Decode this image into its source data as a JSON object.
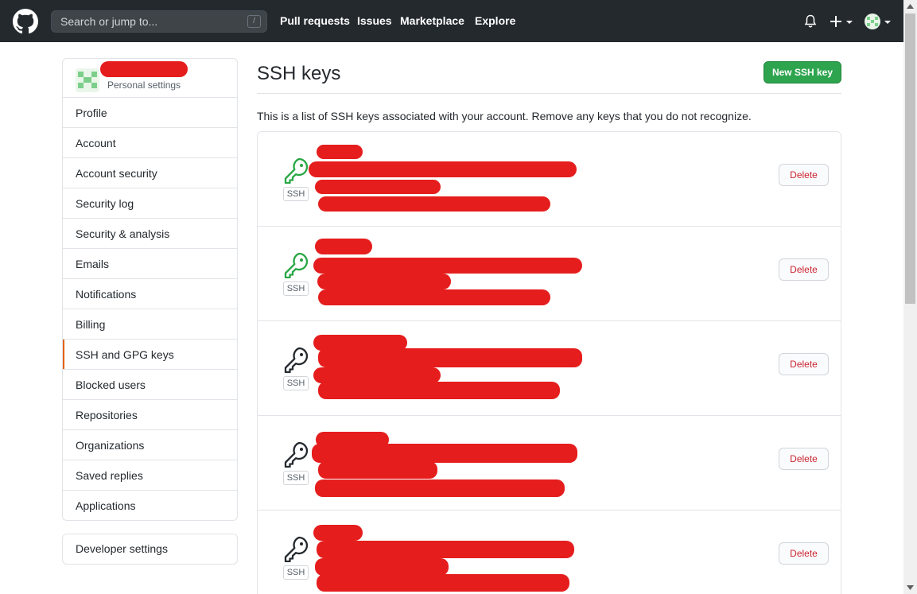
{
  "header": {
    "search_placeholder": "Search or jump to...",
    "search_shortcut": "/",
    "nav": [
      "Pull requests",
      "Issues",
      "Marketplace",
      "Explore"
    ]
  },
  "sidebar": {
    "subtitle": "Personal settings",
    "items": [
      {
        "label": "Profile"
      },
      {
        "label": "Account"
      },
      {
        "label": "Account security"
      },
      {
        "label": "Security log"
      },
      {
        "label": "Security & analysis"
      },
      {
        "label": "Emails"
      },
      {
        "label": "Notifications"
      },
      {
        "label": "Billing"
      },
      {
        "label": "SSH and GPG keys",
        "selected": true
      },
      {
        "label": "Blocked users"
      },
      {
        "label": "Repositories"
      },
      {
        "label": "Organizations"
      },
      {
        "label": "Saved replies"
      },
      {
        "label": "Applications"
      }
    ],
    "developer_settings": "Developer settings"
  },
  "main": {
    "title": "SSH keys",
    "new_button": "New SSH key",
    "description": "This is a list of SSH keys associated with your account. Remove any keys that you do not recognize."
  },
  "keys": [
    {
      "badge": "SSH",
      "delete_label": "Delete",
      "icon_color": "#28a745"
    },
    {
      "badge": "SSH",
      "delete_label": "Delete",
      "icon_color": "#28a745"
    },
    {
      "badge": "SSH",
      "delete_label": "Delete",
      "icon_color": "#24292e"
    },
    {
      "badge": "SSH",
      "delete_label": "Delete",
      "icon_color": "#24292e"
    },
    {
      "badge": "SSH",
      "delete_label": "Delete",
      "icon_color": "#24292e"
    }
  ],
  "colors": {
    "header_bg": "#24292e",
    "accent_green": "#2ea44f",
    "danger_red": "#cb2431",
    "selected_marker": "#e36209",
    "redaction": "#e51d1d"
  }
}
